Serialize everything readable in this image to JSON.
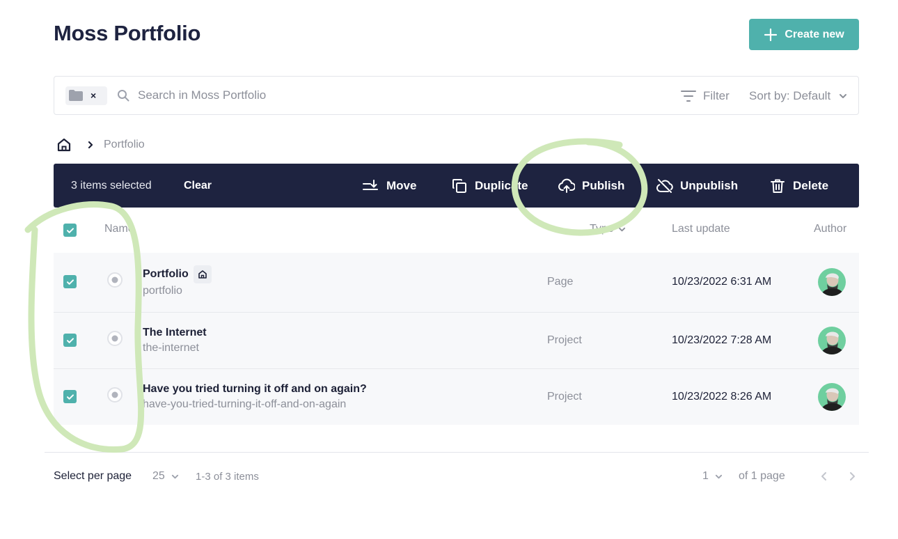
{
  "header": {
    "title": "Moss Portfolio",
    "create_label": "Create new"
  },
  "search": {
    "placeholder": "Search in Moss Portfolio",
    "filter_label": "Filter",
    "sort_label": "Sort by: Default",
    "chip_close": "×"
  },
  "breadcrumb": {
    "current": "Portfolio"
  },
  "action_bar": {
    "selected_text": "3 items selected",
    "clear_label": "Clear",
    "actions": {
      "move": "Move",
      "duplicate": "Duplicate",
      "publish": "Publish",
      "unpublish": "Unpublish",
      "delete": "Delete"
    }
  },
  "table": {
    "columns": {
      "name": "Name",
      "type": "Type",
      "last_update": "Last update",
      "author": "Author"
    },
    "rows": [
      {
        "title": "Portfolio",
        "slug": "portfolio",
        "type": "Page",
        "updated": "10/23/2022 6:31 AM",
        "home": true,
        "checked": true
      },
      {
        "title": "The Internet",
        "slug": "the-internet",
        "type": "Project",
        "updated": "10/23/2022 7:28 AM",
        "home": false,
        "checked": true
      },
      {
        "title": "Have you tried turning it off and on again?",
        "slug": "have-you-tried-turning-it-off-and-on-again",
        "type": "Project",
        "updated": "10/23/2022 8:26 AM",
        "home": false,
        "checked": true
      }
    ]
  },
  "footer": {
    "per_page_label": "Select per page",
    "per_page_value": "25",
    "range": "1-3 of 3 items",
    "page_value": "1",
    "of_pages": "of 1 page"
  },
  "colors": {
    "accent": "#4fb1ac",
    "dark": "#1e2340",
    "highlight": "#cfe8b8"
  }
}
